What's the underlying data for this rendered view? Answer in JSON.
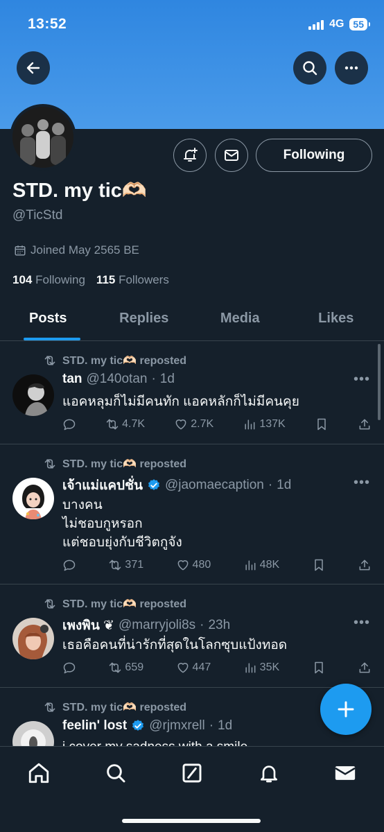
{
  "status_bar": {
    "time": "13:52",
    "network": "4G",
    "battery": "55"
  },
  "profile": {
    "display_name": "STD. my tic🫶🏻",
    "handle": "@TicStd",
    "joined": "Joined May 2565 BE",
    "following_count": "104",
    "following_label": "Following",
    "followers_count": "115",
    "followers_label": "Followers",
    "follow_button_label": "Following"
  },
  "tabs": [
    {
      "label": "Posts",
      "active": true
    },
    {
      "label": "Replies",
      "active": false
    },
    {
      "label": "Media",
      "active": false
    },
    {
      "label": "Likes",
      "active": false
    }
  ],
  "posts": [
    {
      "reposted_by": "STD. my tic🫶🏻 reposted",
      "name": "tan",
      "verified": false,
      "handle": "@140otan",
      "time": "1d",
      "text_lines": [
        "แอคหลุมก็ไม่มีคนทัก แอคหลักก็ไม่มีคนคุย"
      ],
      "reposts": "4.7K",
      "likes": "2.7K",
      "views": "137K"
    },
    {
      "reposted_by": "STD. my tic🫶🏻 reposted",
      "name": "เจ้าแม่แคปชั่น",
      "verified": true,
      "handle": "@jaomaecaption",
      "time": "1d",
      "text_lines": [
        "บางคน",
        "ไม่ชอบกูหรอก",
        "แต่ชอบยุ่งกับชีวิตกูจัง"
      ],
      "reposts": "371",
      "likes": "480",
      "views": "48K"
    },
    {
      "reposted_by": "STD. my tic🫶🏻 reposted",
      "name": "เพงพิน ❦",
      "verified": false,
      "handle": "@marryjoli8s",
      "time": "23h",
      "text_lines": [
        "เธอคือคนที่น่ารักที่สุดในโลกซุบแป้งทอด"
      ],
      "reposts": "659",
      "likes": "447",
      "views": "35K"
    },
    {
      "reposted_by": "STD. my tic🫶🏻 reposted",
      "name": "feelin' lost",
      "verified": true,
      "handle": "@rjmxrell",
      "time": "1d",
      "text_lines": [
        "i cover my sadness with a smile"
      ],
      "reposts": "",
      "likes": "",
      "views": ""
    }
  ],
  "colors": {
    "accent": "#1d9bf0",
    "background": "#15202b",
    "banner": "#3a90e5",
    "muted": "#8b98a5"
  },
  "icons": [
    "back-arrow-icon",
    "search-icon",
    "more-icon",
    "bell-plus-icon",
    "mail-icon",
    "calendar-icon",
    "repost-icon",
    "reply-icon",
    "heart-icon",
    "views-icon",
    "bookmark-icon",
    "share-icon",
    "verified-icon",
    "plus-icon",
    "home-icon",
    "compose-icon",
    "notifications-icon",
    "messages-icon"
  ]
}
